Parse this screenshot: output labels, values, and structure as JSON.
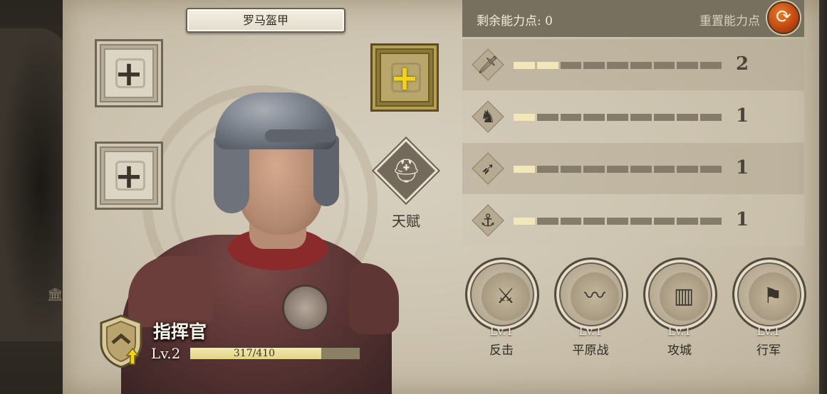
{
  "armor": {
    "title": "罗马盔甲"
  },
  "talent": {
    "label": "天赋"
  },
  "commander": {
    "name": "指挥官",
    "level": "Lv.2",
    "xp_text": "317/410",
    "xp_progress": 0.773
  },
  "points": {
    "remaining_label": "剩余能力点: 0",
    "reset_label": "重置能力点"
  },
  "stats": [
    {
      "icon": "sword-icon",
      "value": "2",
      "filled": 2,
      "segments": 9
    },
    {
      "icon": "horse-icon",
      "value": "1",
      "filled": 1,
      "segments": 9
    },
    {
      "icon": "crossbow-icon",
      "value": "1",
      "filled": 1,
      "segments": 9
    },
    {
      "icon": "anchor-icon",
      "value": "1",
      "filled": 1,
      "segments": 9
    }
  ],
  "skills": [
    {
      "icon": "counterattack-icon",
      "level": "Lv.1",
      "name": "反击"
    },
    {
      "icon": "plains-battle-icon",
      "level": "Lv.1",
      "name": "平原战"
    },
    {
      "icon": "siege-icon",
      "level": "Lv.1",
      "name": "攻城"
    },
    {
      "icon": "march-icon",
      "level": "Lv.1",
      "name": "行军"
    }
  ],
  "colors": {
    "accent_gold": "#f2d21a",
    "reset_orange": "#c24a12",
    "bar_on": "#f2e7b8",
    "bar_off": "#847b68"
  }
}
